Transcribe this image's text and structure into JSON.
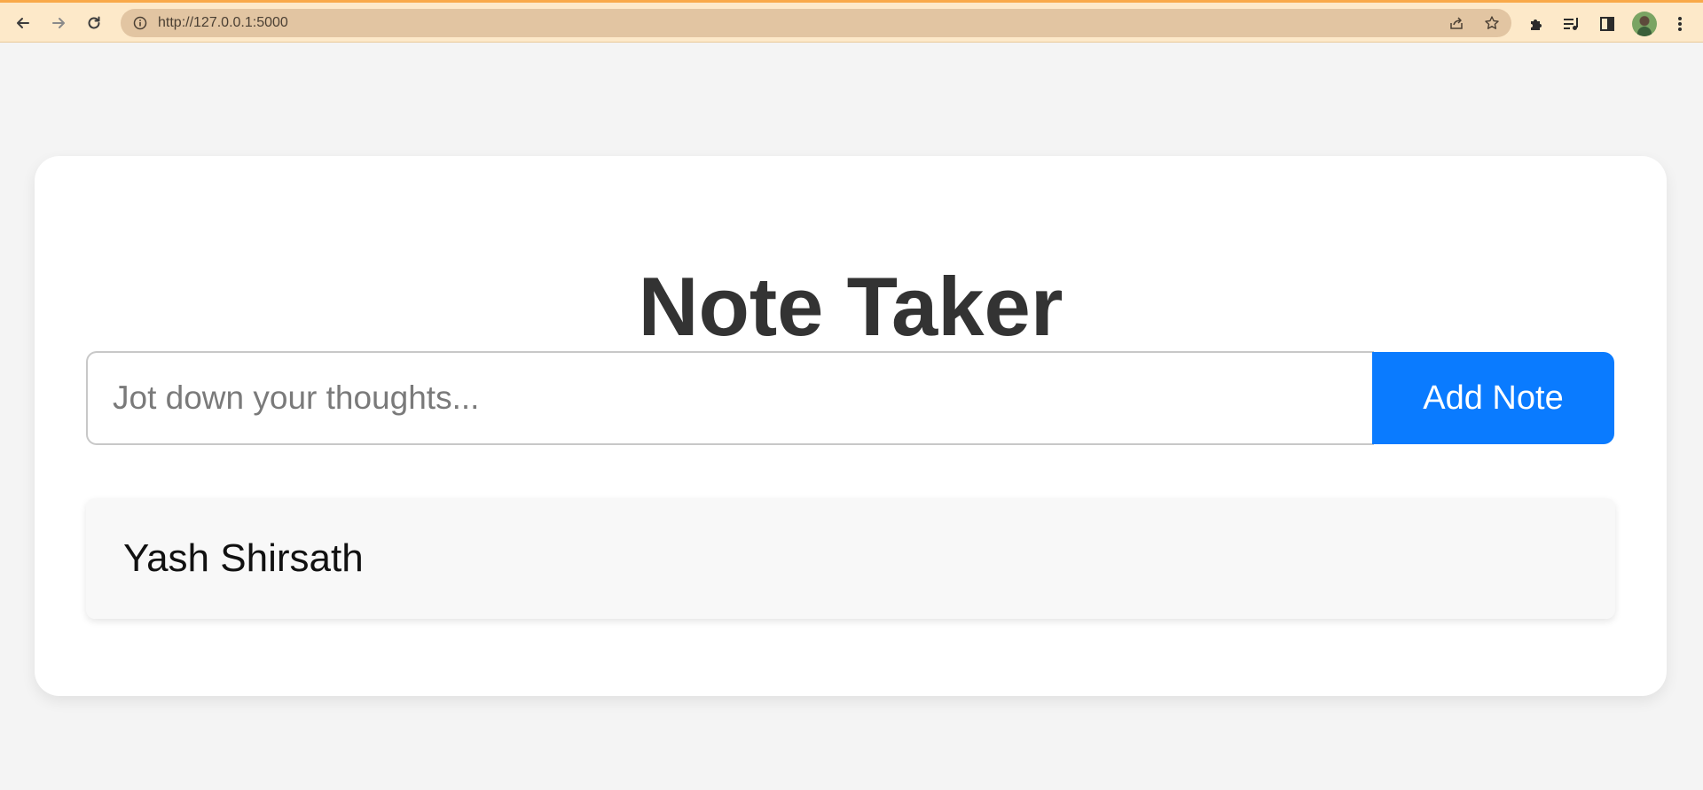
{
  "browser": {
    "url": "http://127.0.0.1:5000",
    "icons": {
      "back": "back-arrow-icon",
      "forward": "forward-arrow-icon",
      "reload": "reload-icon",
      "site_info": "info-icon",
      "share": "share-icon",
      "bookmark": "star-icon",
      "extensions": "puzzle-icon",
      "media": "media-playlist-icon",
      "side_panel": "side-panel-icon",
      "profile": "avatar",
      "menu": "kebab-menu-icon"
    },
    "colors": {
      "toolbar": "#fde9c9",
      "omnibox": "#e2c5a2",
      "accent_line": "#f9a949"
    }
  },
  "app": {
    "title": "Note Taker",
    "input": {
      "placeholder": "Jot down your thoughts...",
      "value": ""
    },
    "add_button_label": "Add Note",
    "notes": [
      {
        "text": "Yash Shirsath"
      }
    ],
    "colors": {
      "background": "#f4f4f4",
      "card": "#ffffff",
      "title": "#333333",
      "button": "#0a7bff",
      "note_bg": "#f8f8f8"
    }
  }
}
